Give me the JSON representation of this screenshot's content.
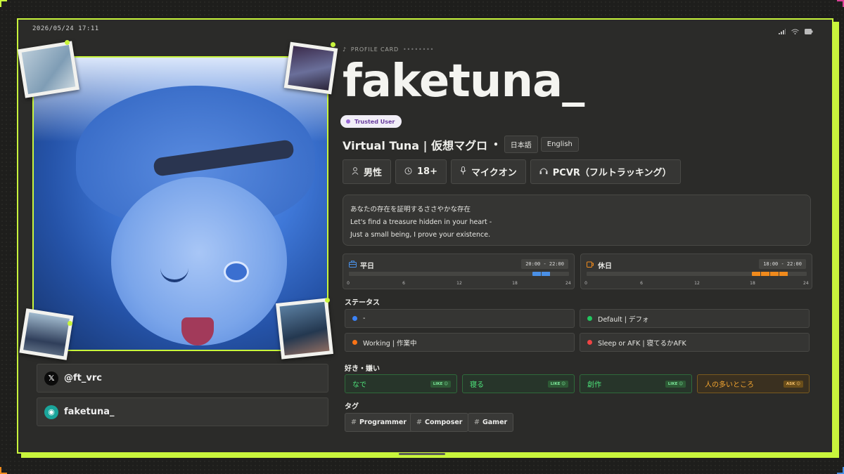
{
  "status_bar": {
    "time": "2026/05/24 17:11"
  },
  "profile_card_label": "PROFILE CARD",
  "profile_card_stars": "••••••••",
  "name": "faketuna_",
  "trusted_badge": "Trusted User",
  "subtitle": "Virtual Tuna | 仮想マグロ",
  "separator": "•",
  "languages": [
    "日本語",
    "English"
  ],
  "chips": [
    {
      "icon": "person-icon",
      "label": "男性"
    },
    {
      "icon": "age-icon",
      "label": "18+"
    },
    {
      "icon": "microphone-icon",
      "label": "マイクオン"
    },
    {
      "icon": "headset-icon",
      "label": "PCVR（フルトラッキング）"
    }
  ],
  "bio": [
    "あなたの存在を証明するささやかな存在",
    "Let's find a treasure hidden in your heart -",
    "Just a small being, I prove your existence."
  ],
  "schedule": {
    "weekday": {
      "label": "平日",
      "range": "20:00 - 22:00",
      "start": 20,
      "end": 22,
      "color": "#4a90e6"
    },
    "holiday": {
      "label": "休日",
      "range": "18:00 - 22:00",
      "start": 18,
      "end": 22,
      "color": "#f08a1c"
    },
    "ticks": [
      "0",
      "6",
      "12",
      "18",
      "24"
    ]
  },
  "status_section": {
    "title": "ステータス",
    "items": [
      {
        "label": "-",
        "color": "#3b82f6"
      },
      {
        "label": "Default | デフォ",
        "color": "#22c55e"
      },
      {
        "label": "Working | 作業中",
        "color": "#f97316"
      },
      {
        "label": "Sleep or AFK | 寝てるかAFK",
        "color": "#ef4444"
      }
    ]
  },
  "likes_section": {
    "title": "好き・嫌い",
    "items": [
      {
        "label": "なで",
        "badge": "LIKE ☺",
        "kind": "like"
      },
      {
        "label": "寝る",
        "badge": "LIKE ☺",
        "kind": "like"
      },
      {
        "label": "創作",
        "badge": "LIKE ☺",
        "kind": "like"
      },
      {
        "label": "人の多いところ",
        "badge": "ASK ☺",
        "kind": "ask"
      }
    ]
  },
  "tags_section": {
    "title": "タグ",
    "hash": "#",
    "items": [
      "Programmer",
      "Composer",
      "Gamer"
    ]
  },
  "socials": [
    {
      "icon": "x-logo-icon",
      "glyph": "𝕏",
      "handle": "@ft_vrc"
    },
    {
      "icon": "discord-icon",
      "glyph": "◉",
      "handle": "faketuna_"
    }
  ],
  "colors": {
    "accent": "#c8f53c",
    "panel": "#353533",
    "frame": "#2b2b29"
  }
}
